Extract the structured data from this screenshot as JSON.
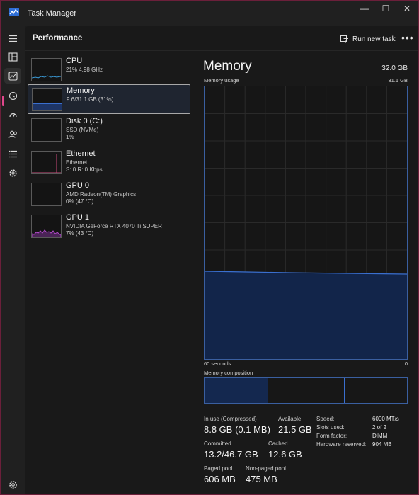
{
  "window": {
    "title": "Task Manager"
  },
  "header": {
    "title": "Performance",
    "run_new_task": "Run new task",
    "more": "•••"
  },
  "resources": [
    {
      "name": "CPU",
      "sub1": "21% 4.98 GHz",
      "sub2": ""
    },
    {
      "name": "Memory",
      "sub1": "9.6/31.1 GB (31%)",
      "sub2": ""
    },
    {
      "name": "Disk 0 (C:)",
      "sub1": "SSD (NVMe)",
      "sub2": "1%"
    },
    {
      "name": "Ethernet",
      "sub1": "Ethernet",
      "sub2": "S: 0 R: 0 Kbps"
    },
    {
      "name": "GPU 0",
      "sub1": "AMD Radeon(TM) Graphics",
      "sub2": "0% (47 °C)"
    },
    {
      "name": "GPU 1",
      "sub1": "NVIDIA GeForce RTX 4070 Ti SUPER",
      "sub2": "7% (43 °C)"
    }
  ],
  "detail": {
    "title": "Memory",
    "total": "32.0 GB",
    "usage_label": "Memory usage",
    "usage_max": "31.1 GB",
    "time_left": "60 seconds",
    "time_right": "0",
    "composition_label": "Memory composition",
    "usage_fraction": 0.31
  },
  "stats": {
    "in_use_label": "In use (Compressed)",
    "in_use_value": "8.8 GB (0.1 MB)",
    "available_label": "Available",
    "available_value": "21.5 GB",
    "committed_label": "Committed",
    "committed_value": "13.2/46.7 GB",
    "cached_label": "Cached",
    "cached_value": "12.6 GB",
    "paged_label": "Paged pool",
    "paged_value": "606 MB",
    "nonpaged_label": "Non-paged pool",
    "nonpaged_value": "475 MB"
  },
  "specs": {
    "speed_label": "Speed:",
    "speed_value": "6000 MT/s",
    "slots_label": "Slots used:",
    "slots_value": "2 of 2",
    "form_label": "Form factor:",
    "form_value": "DIMM",
    "hw_label": "Hardware reserved:",
    "hw_value": "904 MB"
  },
  "colors": {
    "accent": "#e0488c",
    "memory": "#3a6fcf",
    "gpu": "#b04ac8",
    "ethernet": "#c84a7a"
  },
  "icons": [
    "hamburger-icon",
    "processes-icon",
    "performance-icon",
    "app-history-icon",
    "startup-icon",
    "users-icon",
    "details-icon",
    "services-icon",
    "settings-icon"
  ]
}
